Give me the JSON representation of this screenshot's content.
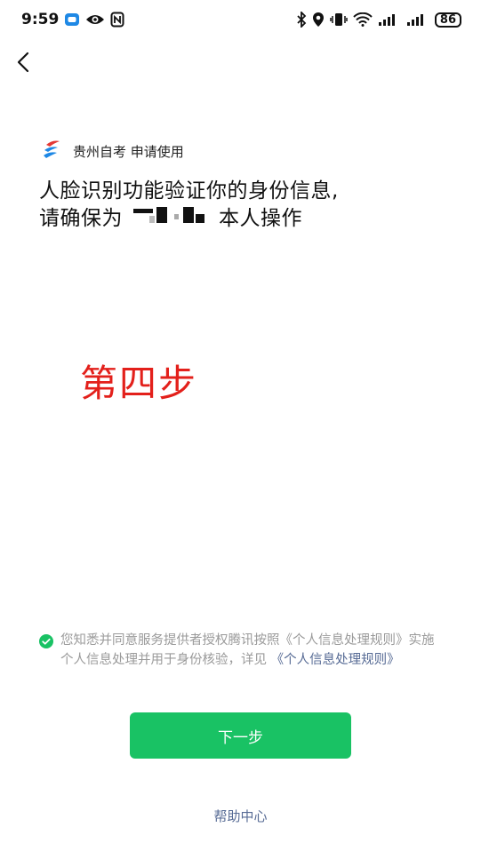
{
  "status_bar": {
    "time": "9:59",
    "battery": "86",
    "icons": [
      "chat-app-icon",
      "eye-icon",
      "nfc-icon",
      "bluetooth-icon",
      "location-icon",
      "vibrate-icon",
      "wifi-icon",
      "signal-icon",
      "signal-icon-2"
    ]
  },
  "nav": {
    "back_icon": "chevron-left-icon"
  },
  "app": {
    "name": "贵州自考",
    "request_text": "申请使用",
    "logo_icon": "guizhou-zikao-logo"
  },
  "headline": {
    "line1": "人脸识别功能验证你的身份信息,",
    "line2_prefix": "请确保为",
    "line2_suffix": "本人操作"
  },
  "overlay": {
    "step_label": "第四步",
    "color": "#e3201b"
  },
  "agreement": {
    "text_part1": "您知悉并同意服务提供者授权腾讯按照《个人信息处理规则》实施个人信息处理并用于身份核验，详见",
    "link_text": "《个人信息处理规则》",
    "checked": true
  },
  "actions": {
    "next_label": "下一步",
    "help_label": "帮助中心"
  },
  "colors": {
    "primary": "#19c264",
    "link": "#576b95",
    "annotation": "#e3201b"
  }
}
